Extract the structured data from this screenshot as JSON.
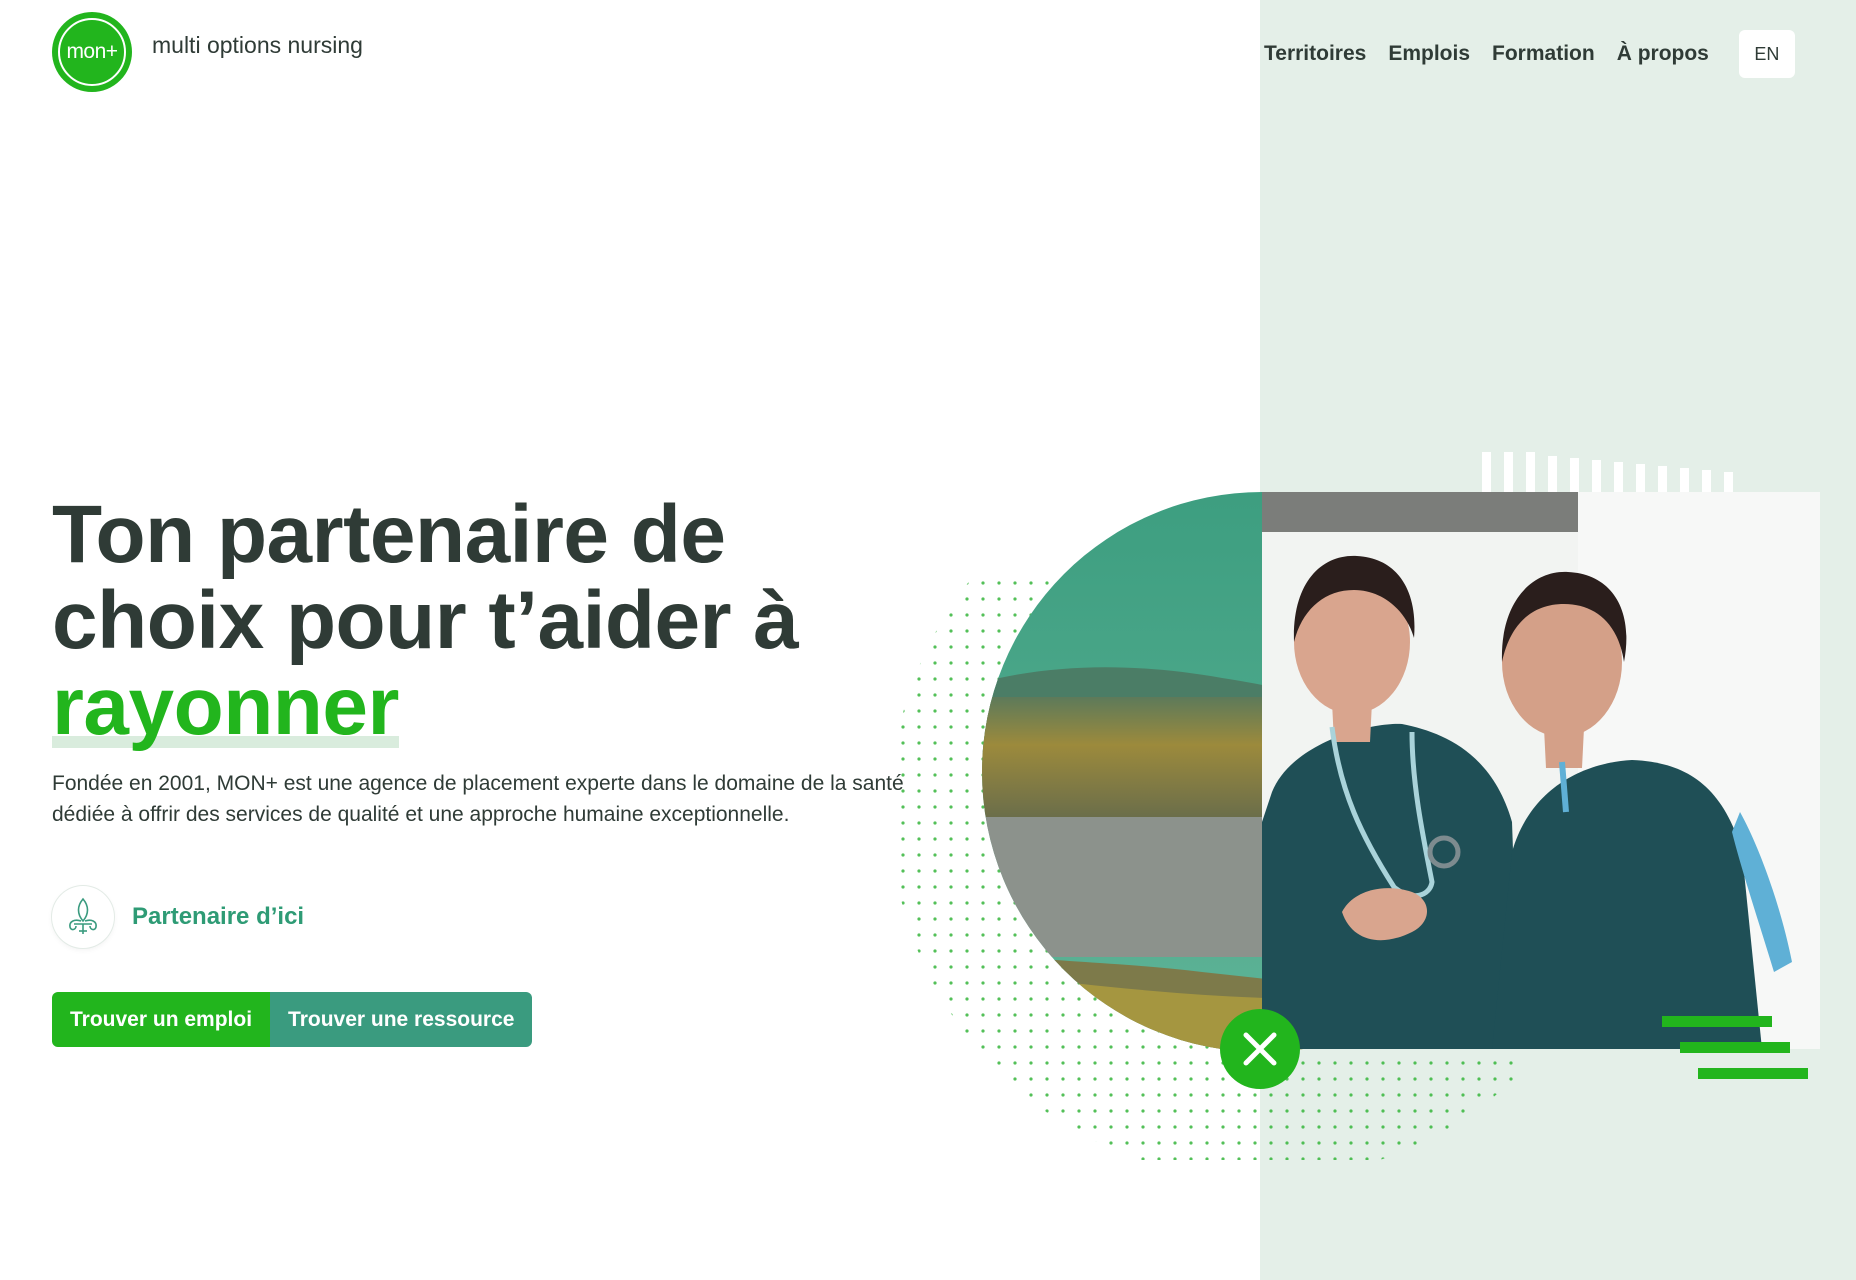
{
  "brand": {
    "logo_text": "mon+",
    "name": "multi options nursing"
  },
  "nav": {
    "links": [
      "Territoires",
      "Emplois",
      "Formation",
      "À propos"
    ],
    "lang": "EN"
  },
  "hero": {
    "headline_line1": "Ton partenaire de",
    "headline_line2": "choix pour t’aider à",
    "headline_highlight": "rayonner",
    "description": "Fondée en 2001, MON+ est une agence de placement experte dans le domaine de la santé dédiée à offrir des services de qualité et une approche humaine exceptionnelle.",
    "partner_label": "Partenaire d’ici",
    "buttons": {
      "primary": "Trouver un emploi",
      "secondary": "Trouver une ressource"
    }
  },
  "colors": {
    "brand_green": "#22b51d",
    "teal": "#3a9b7f",
    "panel_bg": "#e4efe8",
    "text_dark": "#2f3b36"
  },
  "icons": [
    "fleur-de-lis-icon",
    "close-icon"
  ]
}
